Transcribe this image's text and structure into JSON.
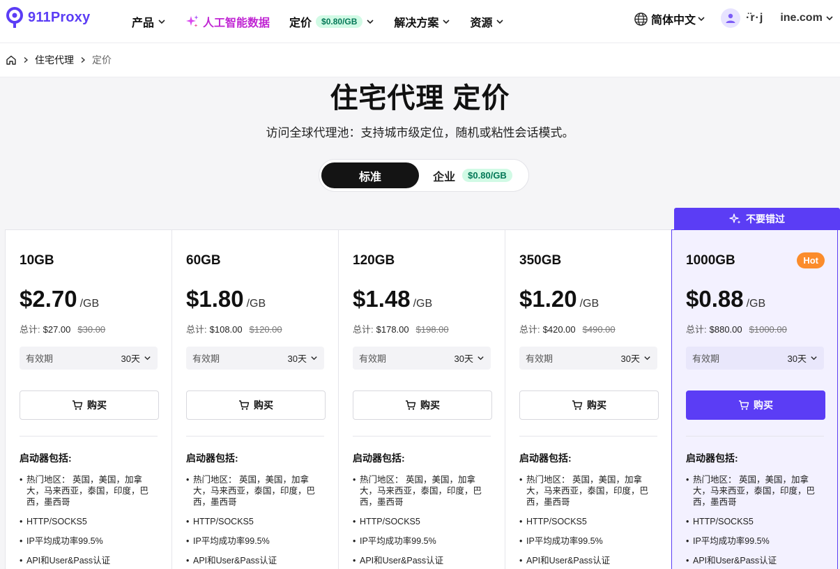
{
  "header": {
    "logo_text": "911Proxy",
    "nav": [
      {
        "label": "产品"
      },
      {
        "label": "人工智能数据"
      },
      {
        "label": "定价",
        "badge": "$0.80/GB"
      },
      {
        "label": "解决方案"
      },
      {
        "label": "资源"
      }
    ],
    "language": "简体中文",
    "user_name": "·̈r·j",
    "user_email": "ine.com"
  },
  "breadcrumb": {
    "items": [
      "住宅代理",
      "定价"
    ]
  },
  "hero": {
    "title": "住宅代理 定价",
    "subtitle": "访问全球代理池：支持城市级定位，随机或粘性会话模式。"
  },
  "toggle": {
    "active": "标准",
    "inactive": "企业",
    "inactive_badge": "$0.80/GB"
  },
  "ribbon": "不要错过",
  "common": {
    "total_label": "总计:",
    "unit": "/GB",
    "validity_label": "有效期",
    "validity_value": "30天",
    "buy_label": "购买",
    "includes_title": "启动器包括:",
    "hot_label": "Hot"
  },
  "features": [
    "热门地区： 英国，美国，加拿大，马来西亚，泰国，印度，巴西，墨西哥",
    "HTTP/SOCKS5",
    "IP平均成功率99.5%",
    "API和User&Pass认证"
  ],
  "plans": [
    {
      "size": "10GB",
      "price": "$2.70",
      "total": "$27.00",
      "old": "$30.00"
    },
    {
      "size": "60GB",
      "price": "$1.80",
      "total": "$108.00",
      "old": "$120.00"
    },
    {
      "size": "120GB",
      "price": "$1.48",
      "total": "$178.00",
      "old": "$198.00"
    },
    {
      "size": "350GB",
      "price": "$1.20",
      "total": "$420.00",
      "old": "$490.00"
    },
    {
      "size": "1000GB",
      "price": "$0.88",
      "total": "$880.00",
      "old": "$1000.00"
    }
  ],
  "colors": {
    "brand": "#5b3df5",
    "ai": "#c026d3",
    "badge_bg": "#d1fae5",
    "badge_text": "#047857",
    "hot": "#fb8c2b"
  }
}
